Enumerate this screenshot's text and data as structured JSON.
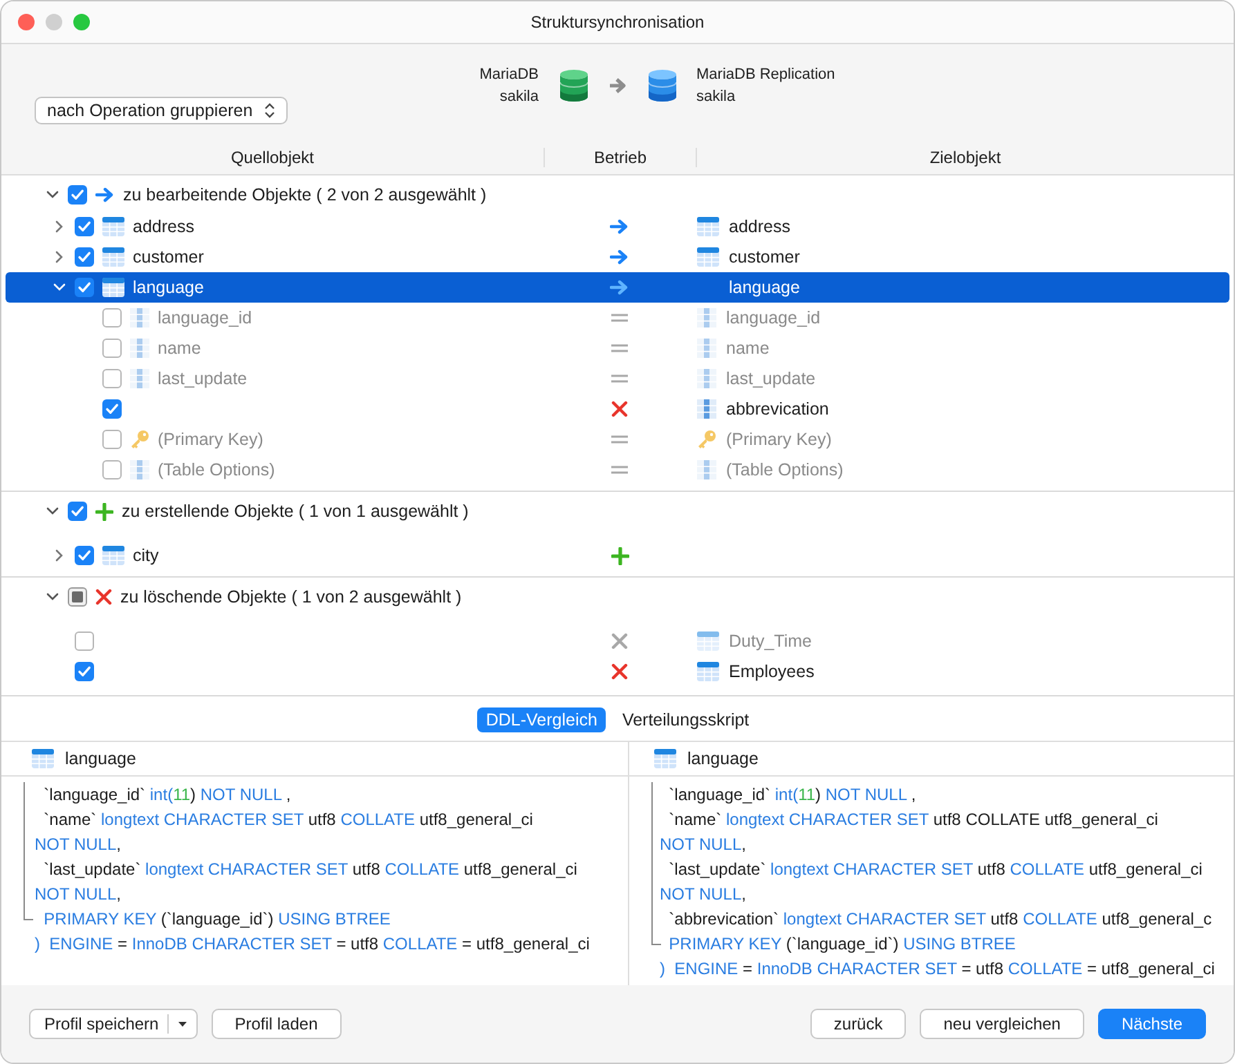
{
  "window": {
    "title": "Struktursynchronisation"
  },
  "source": {
    "name": "MariaDB",
    "schema": "sakila"
  },
  "target": {
    "name": "MariaDB Replication",
    "schema": "sakila"
  },
  "group_select": {
    "value": "nach Operation gruppieren"
  },
  "columns": [
    "Quellobjekt",
    "Betrieb",
    "Zielobjekt"
  ],
  "groups": [
    {
      "label": "zu bearbeitende Objekte ( 2 von 2 ausgewählt )",
      "op": {
        "kind": "modify"
      },
      "checked": true,
      "partial": false,
      "expanded": true,
      "children": [
        {
          "kind": "table",
          "source": "address",
          "target": "address",
          "op": {
            "kind": "modify"
          },
          "checked": true,
          "dimmed": false,
          "selected": false,
          "expanded": false
        },
        {
          "kind": "table",
          "source": "customer",
          "target": "customer",
          "op": {
            "kind": "modify"
          },
          "checked": true,
          "dimmed": false,
          "selected": false,
          "expanded": false
        },
        {
          "kind": "table",
          "source": "language",
          "target": "language",
          "op": {
            "kind": "modify"
          },
          "checked": true,
          "dimmed": false,
          "selected": true,
          "expanded": true,
          "children": [
            {
              "kind": "column",
              "source": "language_id",
              "target": "language_id",
              "op": {
                "kind": "equal"
              },
              "checked": false,
              "dimmed": true,
              "selected": false
            },
            {
              "kind": "column",
              "source": "name",
              "target": "name",
              "op": {
                "kind": "equal"
              },
              "checked": false,
              "dimmed": true,
              "selected": false
            },
            {
              "kind": "column",
              "source": "last_update",
              "target": "last_update",
              "op": {
                "kind": "equal"
              },
              "checked": false,
              "dimmed": true,
              "selected": false
            },
            {
              "kind": "column",
              "target": "abbrevication",
              "op": {
                "kind": "drop"
              },
              "checked": true,
              "dimmed": false,
              "selected": false
            },
            {
              "kind": "key",
              "source": "(Primary Key)",
              "target": "(Primary Key)",
              "op": {
                "kind": "equal"
              },
              "checked": false,
              "dimmed": true,
              "selected": false
            },
            {
              "kind": "column",
              "source": "(Table Options)",
              "target": "(Table Options)",
              "op": {
                "kind": "equal"
              },
              "checked": false,
              "dimmed": true,
              "selected": false
            }
          ]
        }
      ]
    },
    {
      "label": "zu erstellende Objekte ( 1 von 1 ausgewählt )",
      "op": {
        "kind": "create"
      },
      "checked": true,
      "partial": false,
      "expanded": true,
      "children": [
        {
          "kind": "table",
          "source": "city",
          "op": {
            "kind": "create"
          },
          "checked": true,
          "dimmed": false,
          "selected": false,
          "expanded": false
        }
      ]
    },
    {
      "label": "zu löschende Objekte ( 1 von 2 ausgewählt )",
      "op": {
        "kind": "drop"
      },
      "checked": false,
      "partial": true,
      "expanded": true,
      "children": [
        {
          "kind": "table",
          "target": "Duty_Time",
          "op": {
            "kind": "drop"
          },
          "checked": false,
          "dimmed": true,
          "selected": false
        },
        {
          "kind": "table",
          "target": "Employees",
          "op": {
            "kind": "drop"
          },
          "checked": true,
          "dimmed": false,
          "selected": false
        }
      ]
    }
  ],
  "tabs": [
    {
      "label": "DDL-Vergleich",
      "selected": true
    },
    {
      "label": "Verteilungsskript",
      "selected": false
    }
  ],
  "ddl_panes": [
    {
      "title": "language",
      "lines": [
        [
          {
            "kind": "plain",
            "text": "  `language_id` "
          },
          {
            "kind": "keyword",
            "text": "int("
          },
          {
            "kind": "number",
            "text": "11"
          },
          {
            "kind": "plain",
            "text": ") "
          },
          {
            "kind": "keyword",
            "text": "NOT NULL"
          },
          {
            "kind": "plain",
            "text": " ,"
          }
        ],
        [
          {
            "kind": "plain",
            "text": "  `name` "
          },
          {
            "kind": "keyword",
            "text": "longtext CHARACTER SET "
          },
          {
            "kind": "plain",
            "text": "utf8 "
          },
          {
            "kind": "keyword",
            "text": "COLLATE "
          },
          {
            "kind": "plain",
            "text": "utf8_general_ci"
          }
        ],
        [
          {
            "kind": "keyword",
            "text": "NOT NULL"
          },
          {
            "kind": "plain",
            "text": ","
          }
        ],
        [
          {
            "kind": "plain",
            "text": "  `last_update` "
          },
          {
            "kind": "keyword",
            "text": "longtext CHARACTER SET "
          },
          {
            "kind": "plain",
            "text": "utf8 "
          },
          {
            "kind": "keyword",
            "text": "COLLATE "
          },
          {
            "kind": "plain",
            "text": "utf8_general_ci"
          }
        ],
        [
          {
            "kind": "keyword",
            "text": "NOT NULL"
          },
          {
            "kind": "plain",
            "text": ","
          }
        ],
        [
          {
            "kind": "keyword",
            "text": "  PRIMARY KEY "
          },
          {
            "kind": "plain",
            "text": "(`language_id`) "
          },
          {
            "kind": "keyword",
            "text": "USING BTREE"
          }
        ],
        [
          {
            "kind": "keyword",
            "text": ")  ENGINE "
          },
          {
            "kind": "plain",
            "text": "= "
          },
          {
            "kind": "keyword",
            "text": "InnoDB CHARACTER SET "
          },
          {
            "kind": "plain",
            "text": "= utf8 "
          },
          {
            "kind": "keyword",
            "text": "COLLATE "
          },
          {
            "kind": "plain",
            "text": "= utf8_general_ci"
          }
        ]
      ]
    },
    {
      "title": "language",
      "lines": [
        [
          {
            "kind": "plain",
            "text": "  `language_id` "
          },
          {
            "kind": "keyword",
            "text": "int("
          },
          {
            "kind": "number",
            "text": "11"
          },
          {
            "kind": "plain",
            "text": ") "
          },
          {
            "kind": "keyword",
            "text": "NOT NULL"
          },
          {
            "kind": "plain",
            "text": " ,"
          }
        ],
        [
          {
            "kind": "plain",
            "text": "  `name` "
          },
          {
            "kind": "keyword",
            "text": "longtext CHARACTER SET "
          },
          {
            "kind": "plain",
            "text": "utf8 COLLATE utf8_general_ci"
          }
        ],
        [
          {
            "kind": "keyword",
            "text": "NOT NULL"
          },
          {
            "kind": "plain",
            "text": ","
          }
        ],
        [
          {
            "kind": "plain",
            "text": "  `last_update` "
          },
          {
            "kind": "keyword",
            "text": "longtext CHARACTER SET "
          },
          {
            "kind": "plain",
            "text": "utf8 "
          },
          {
            "kind": "keyword",
            "text": "COLLATE "
          },
          {
            "kind": "plain",
            "text": "utf8_general_ci"
          }
        ],
        [
          {
            "kind": "keyword",
            "text": "NOT NULL"
          },
          {
            "kind": "plain",
            "text": ","
          }
        ],
        [
          {
            "kind": "plain",
            "text": "  `abbrevication` "
          },
          {
            "kind": "keyword",
            "text": "longtext CHARACTER SET "
          },
          {
            "kind": "plain",
            "text": "utf8 "
          },
          {
            "kind": "keyword",
            "text": "COLLATE "
          },
          {
            "kind": "plain",
            "text": "utf8_general_c"
          }
        ],
        [
          {
            "kind": "keyword",
            "text": "  PRIMARY KEY "
          },
          {
            "kind": "plain",
            "text": "(`language_id`) "
          },
          {
            "kind": "keyword",
            "text": "USING BTREE"
          }
        ],
        [
          {
            "kind": "keyword",
            "text": ")  ENGINE "
          },
          {
            "kind": "plain",
            "text": "= "
          },
          {
            "kind": "keyword",
            "text": "InnoDB CHARACTER SET "
          },
          {
            "kind": "plain",
            "text": "= utf8 "
          },
          {
            "kind": "keyword",
            "text": "COLLATE "
          },
          {
            "kind": "plain",
            "text": "= utf8_general_ci"
          }
        ]
      ]
    }
  ],
  "footer": {
    "left": [
      "Profil speichern",
      "Profil laden"
    ],
    "right": [
      {
        "label": "zurück",
        "primary": false
      },
      {
        "label": "neu vergleichen",
        "primary": false
      },
      {
        "label": "Nächste",
        "primary": true
      }
    ]
  }
}
